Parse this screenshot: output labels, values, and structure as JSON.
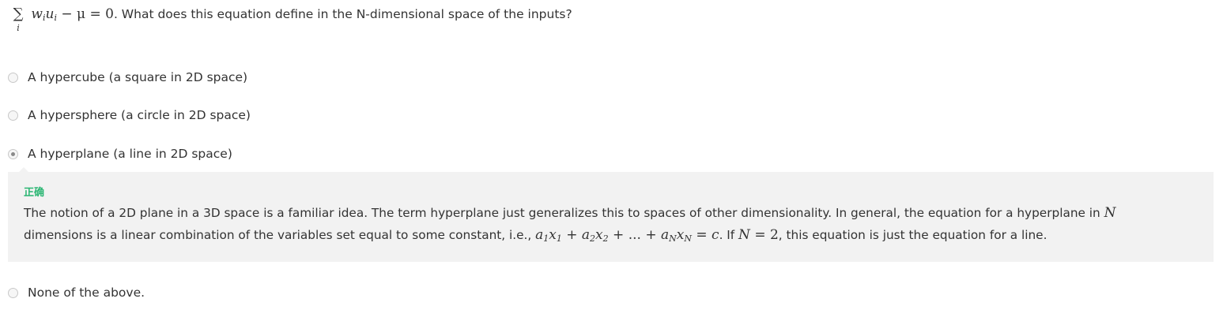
{
  "question": {
    "sum_symbol": "∑",
    "sum_index": "i",
    "equation": "wᵢuᵢ − μ = 0",
    "w": "w",
    "i1": "i",
    "u": "u",
    "i2": "i",
    "rest": " − μ = 0",
    "text": ". What does this equation define in the N-dimensional space of the inputs?"
  },
  "options": [
    {
      "label": "A hypercube (a square in 2D space)",
      "selected": false
    },
    {
      "label": "A hypersphere (a circle in 2D space)",
      "selected": false
    },
    {
      "label": "A hyperplane (a line in 2D space)",
      "selected": true
    },
    {
      "label": "None of the above.",
      "selected": false
    }
  ],
  "feedback": {
    "status": "正确",
    "status_color": "#2bb673",
    "line1_text": "The notion of a 2D plane in a 3D space is a familiar idea. The term hyperplane just generalizes this to spaces of other dimensionality. In general, the equation for a hyperplane in ",
    "line1_math": "N",
    "line2_text_a": "dimensions is a linear combination of the variables set equal to some constant, i.e., ",
    "formula": {
      "a": "a",
      "x": "x",
      "s1": "1",
      "s2": "2",
      "sN": "N",
      "plus": " + ",
      "dots": "...",
      "eq": " = ",
      "c": "c"
    },
    "line2_text_b": ". If ",
    "n_math": "N",
    "n_eq": " = 2",
    "line2_text_c": ", this equation is just the equation for a line."
  },
  "colors": {
    "text": "#333333",
    "feedback_bg": "#f2f2f2",
    "correct": "#2bb673",
    "radio_border": "#c8c8c8"
  }
}
